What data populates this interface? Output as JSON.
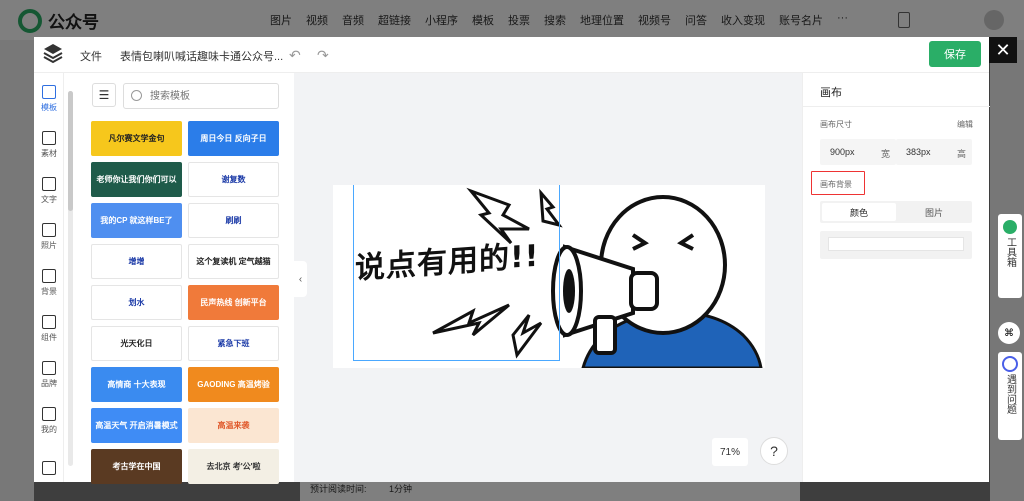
{
  "app": {
    "title": "公众号"
  },
  "topnav": [
    "图片",
    "视频",
    "音频",
    "超链接",
    "小程序",
    "模板",
    "投票",
    "搜索",
    "地理位置",
    "视频号",
    "问答",
    "收入变现",
    "账号名片",
    "···"
  ],
  "background": {
    "read_time_label": "预计阅读时间:",
    "read_time_value": "1分钟"
  },
  "modal": {
    "file_label": "文件",
    "doc_title": "表情包喇叭喊话趣味卡通公众号...",
    "save_label": "保存",
    "close_label": "✕"
  },
  "rail": [
    {
      "label": "模板",
      "icon": "template-icon",
      "active": true
    },
    {
      "label": "素材",
      "icon": "shapes-icon",
      "active": false
    },
    {
      "label": "文字",
      "icon": "text-icon",
      "active": false
    },
    {
      "label": "照片",
      "icon": "image-icon",
      "active": false
    },
    {
      "label": "背景",
      "icon": "background-icon",
      "active": false
    },
    {
      "label": "组件",
      "icon": "component-icon",
      "active": false
    },
    {
      "label": "品牌",
      "icon": "brand-icon",
      "active": false
    },
    {
      "label": "我的",
      "icon": "my-icon",
      "active": false
    }
  ],
  "panel": {
    "search_placeholder": "搜索模板",
    "tiles": [
      {
        "text": "凡尔赛文学金句",
        "bg": "#f6c71c",
        "fg": "#222"
      },
      {
        "text": "周日今日 反向子日",
        "bg": "#2b7de9",
        "fg": "#fff"
      },
      {
        "text": "老师你让我们你们可以",
        "bg": "#1f5b4a",
        "fg": "#fff"
      },
      {
        "text": "谢复数",
        "bg": "#ffffff",
        "fg": "#1b3aa7"
      },
      {
        "text": "我的CP 就这样BE了",
        "bg": "#4f8ff0",
        "fg": "#fff"
      },
      {
        "text": "刷刷",
        "bg": "#ffffff",
        "fg": "#1b3aa7"
      },
      {
        "text": "增增",
        "bg": "#ffffff",
        "fg": "#1b3aa7"
      },
      {
        "text": "这个复读机 定气越猫",
        "bg": "#ffffff",
        "fg": "#222"
      },
      {
        "text": "划水",
        "bg": "#ffffff",
        "fg": "#1b3aa7"
      },
      {
        "text": "民声热线 创新平台",
        "bg": "#f07a3a",
        "fg": "#fff"
      },
      {
        "text": "光天化日",
        "bg": "#ffffff",
        "fg": "#222"
      },
      {
        "text": "紧急下班",
        "bg": "#ffffff",
        "fg": "#1b3aa7"
      },
      {
        "text": "高情商 十大表现",
        "bg": "#3a8bf0",
        "fg": "#fff"
      },
      {
        "text": "GAODING 高温烤验",
        "bg": "#f08a1e",
        "fg": "#fff"
      },
      {
        "text": "高温天气 开启消暑模式",
        "bg": "#3f8cf5",
        "fg": "#fff"
      },
      {
        "text": "高温来袭",
        "bg": "#fbe6d2",
        "fg": "#e0582a"
      },
      {
        "text": "考古学在中国",
        "bg": "#5a3a22",
        "fg": "#fff"
      },
      {
        "text": "去北京 考'公'啦",
        "bg": "#f3efe4",
        "fg": "#333"
      }
    ]
  },
  "canvas": {
    "headline": "说点有用的!!",
    "zoom": "71%",
    "help": "?"
  },
  "props": {
    "title": "画布",
    "size_label": "画布尺寸",
    "edit_label": "编辑",
    "width_value": "900px",
    "width_unit": "宽",
    "height_value": "383px",
    "height_unit": "高",
    "bg_label": "画布背景",
    "tab_color": "颜色",
    "tab_image": "图片"
  },
  "widgets": {
    "toolbox_label": "工具箱",
    "ask_label": "遇到问题"
  },
  "colors": {
    "accent_green": "#2aae67",
    "selection": "#4aa8ff",
    "highlight_red": "#e33333",
    "canvas_blue": "#1f63b8"
  }
}
